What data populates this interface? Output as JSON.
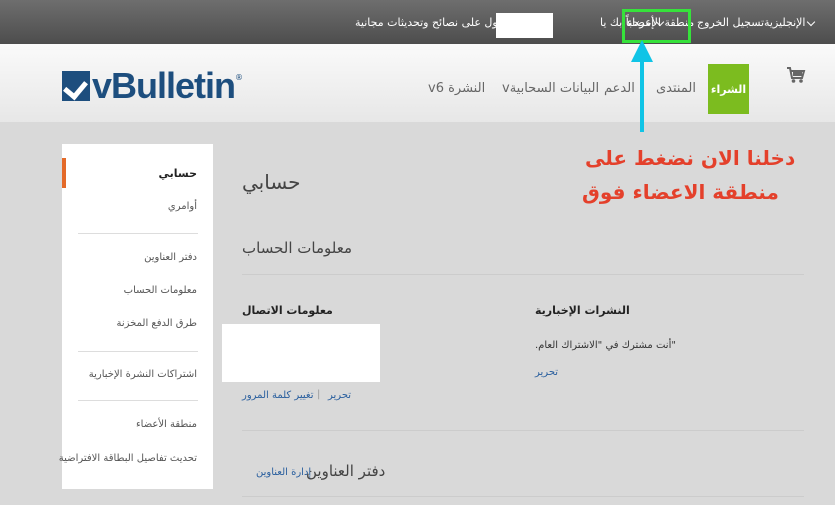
{
  "topbar": {
    "language": "الإنجليزية",
    "logout": "تسجيل الخروج",
    "members_area": "منطقة الأعضاء",
    "welcome": "إمرحباً بك يا",
    "newsletter": "الحصول على نصائح وتحديثات مجانية"
  },
  "header": {
    "logo_text": "vBulletin",
    "logo_mark": "®",
    "nav": [
      "النشرة v6",
      "البيانات السحابيةv",
      "الدعم",
      "المنتدى"
    ],
    "buy_label": "الشراء",
    "cart_icon": "shopping-cart-icon"
  },
  "annotation": {
    "line1": "دخلنا الان نضغط على",
    "line2": "منطقة الاعضاء فوق",
    "arrow_color": "#10c4e6",
    "text_color": "#e4402b",
    "highlight_color": "#36e23b"
  },
  "sidebar": {
    "active": "حسابي",
    "orders": "أوامري",
    "address_book": "دفتر العناوين",
    "account_info": "معلومات الحساب",
    "stored_payments": "طرق الدفع المخزنة",
    "newsletter_subs": "اشتراكات النشرة الإخبارية",
    "members_area": "منطقة الأعضاء",
    "update_card": "تحديث تفاصيل البطاقة الافتراضية"
  },
  "main": {
    "title": "حسابي",
    "account_info_heading": "معلومات الحساب",
    "contact_info": "معلومات الاتصال",
    "edit": "تحرير",
    "change_password": "تغيير كلمة المرور",
    "newsletters": "النشرات الإخبارية",
    "subscribed_text": "\"أنت مشترك في \"الاشتراك العام.",
    "newsletter_edit": "تحرير",
    "address_book_heading": "دفتر العناوين",
    "manage_addresses": "إدارة العناوين"
  }
}
